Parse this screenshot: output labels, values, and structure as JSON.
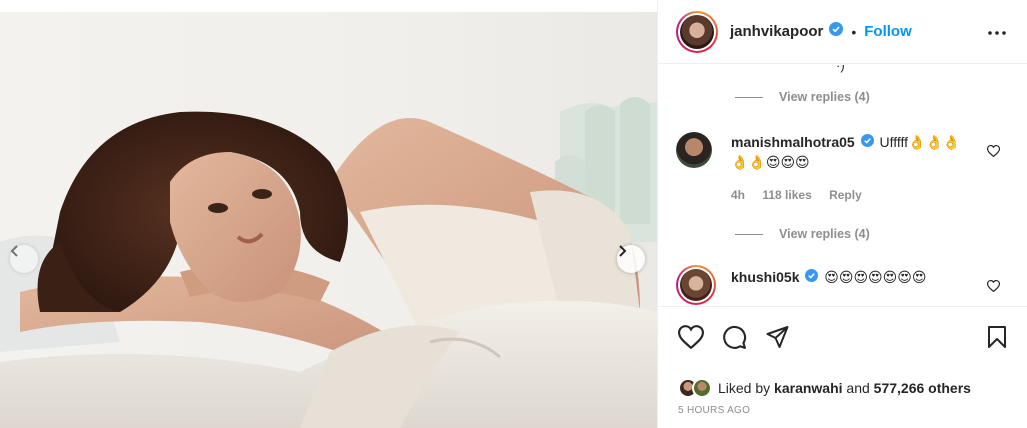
{
  "post": {
    "username": "janhvikapoor",
    "separator": "•",
    "follow_label": "Follow",
    "more_icon": "more-horizontal-icon"
  },
  "comments": {
    "truncated_text": "·)",
    "view_replies_1": "View replies (4)",
    "items": [
      {
        "username": "manishmalhotra05",
        "text": "Ufffff👌👌👌",
        "text_line2": "👌👌😍😍😍",
        "time": "4h",
        "likes": "118 likes",
        "reply_label": "Reply"
      },
      {
        "username": "khushi05k",
        "text": "😍😍😍😍😍😍😍"
      }
    ],
    "view_replies_2": "View replies (4)"
  },
  "actions": {
    "like_icon": "heart-icon",
    "comment_icon": "comment-icon",
    "share_icon": "send-icon",
    "save_icon": "bookmark-icon"
  },
  "likes": {
    "prefix": "Liked by",
    "user": "karanwahi",
    "middle": "and",
    "others": "577,266 others"
  },
  "timestamp": "5 HOURS AGO",
  "colors": {
    "link_blue": "#0095f6",
    "verified_blue": "#3897f0",
    "muted": "#8e8e8e"
  }
}
